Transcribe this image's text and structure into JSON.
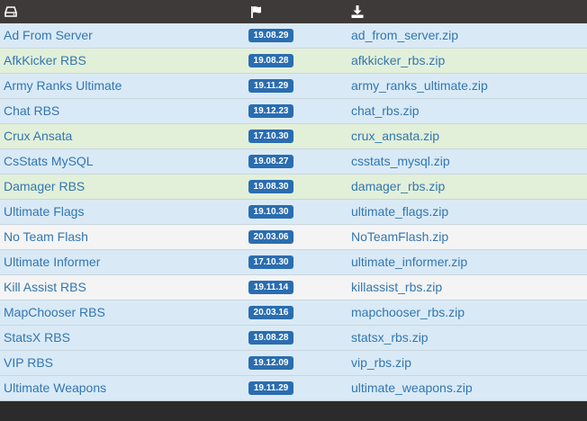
{
  "header": {
    "col_name_icon": "drive-icon",
    "col_date_icon": "flag-icon",
    "col_file_icon": "download-icon"
  },
  "rows": [
    {
      "name": "Ad From Server",
      "date": "19.08.29",
      "file": "ad_from_server.zip",
      "tint": "blue"
    },
    {
      "name": "AfkKicker RBS",
      "date": "19.08.28",
      "file": "afkkicker_rbs.zip",
      "tint": "green"
    },
    {
      "name": "Army Ranks Ultimate",
      "date": "19.11.29",
      "file": "army_ranks_ultimate.zip",
      "tint": "blue"
    },
    {
      "name": "Chat RBS",
      "date": "19.12.23",
      "file": "chat_rbs.zip",
      "tint": "blue"
    },
    {
      "name": "Crux Ansata",
      "date": "17.10.30",
      "file": "crux_ansata.zip",
      "tint": "green"
    },
    {
      "name": "CsStats MySQL",
      "date": "19.08.27",
      "file": "csstats_mysql.zip",
      "tint": "blue"
    },
    {
      "name": "Damager RBS",
      "date": "19.08.30",
      "file": "damager_rbs.zip",
      "tint": "green"
    },
    {
      "name": "Ultimate Flags",
      "date": "19.10.30",
      "file": "ultimate_flags.zip",
      "tint": "blue"
    },
    {
      "name": "No Team Flash",
      "date": "20.03.06",
      "file": "NoTeamFlash.zip",
      "tint": "gray"
    },
    {
      "name": "Ultimate Informer",
      "date": "17.10.30",
      "file": "ultimate_informer.zip",
      "tint": "blue"
    },
    {
      "name": "Kill Assist RBS",
      "date": "19.11.14",
      "file": "killassist_rbs.zip",
      "tint": "gray"
    },
    {
      "name": "MapChooser RBS",
      "date": "20.03.16",
      "file": "mapchooser_rbs.zip",
      "tint": "blue"
    },
    {
      "name": "StatsX RBS",
      "date": "19.08.28",
      "file": "statsx_rbs.zip",
      "tint": "blue"
    },
    {
      "name": "VIP RBS",
      "date": "19.12.09",
      "file": "vip_rbs.zip",
      "tint": "blue"
    },
    {
      "name": "Ultimate Weapons",
      "date": "19.11.29",
      "file": "ultimate_weapons.zip",
      "tint": "blue"
    }
  ]
}
